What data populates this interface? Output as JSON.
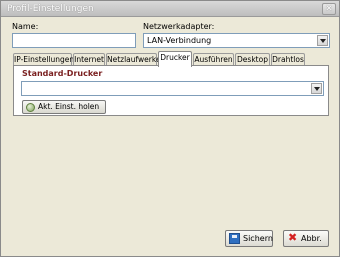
{
  "window": {
    "title": "Profil-Einstellungen",
    "close_symbol": "✕"
  },
  "form": {
    "name_label": "Name:",
    "name_value": "",
    "adapter_label": "Netzwerkadapter:",
    "adapter_value": "LAN-Verbindung"
  },
  "tabs": [
    {
      "label": "IP-Einstellungen",
      "active": false
    },
    {
      "label": "Internet",
      "active": false
    },
    {
      "label": "Netzlaufwerke",
      "active": false
    },
    {
      "label": "Drucker",
      "active": true
    },
    {
      "label": "Ausführen",
      "active": false
    },
    {
      "label": "Desktop",
      "active": false
    },
    {
      "label": "Drahtlos",
      "active": false
    }
  ],
  "printer_tab": {
    "group_title": "Standard-Drucker",
    "printer_value": "",
    "fetch_button_label": "Akt. Einst. holen"
  },
  "footer": {
    "save_label": "Sichern",
    "cancel_label": "Abbr.",
    "cancel_symbol": "✖"
  },
  "colors": {
    "group_title": "#7a1f1f",
    "field_border": "#7f9db9",
    "dialog_background": "#ece9d8"
  }
}
